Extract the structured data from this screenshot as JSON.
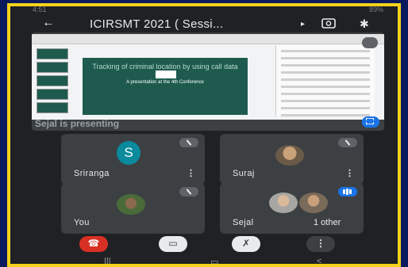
{
  "status_bar": {
    "time": "4:51",
    "battery": "89%"
  },
  "app_bar": {
    "title": "ICIRSMT 2021 ( Sessi...",
    "back_icon": "arrow-left-icon",
    "cast_icon": "cast-icon",
    "camera_icon": "camera-flip-icon",
    "audio_icon": "bluetooth-icon"
  },
  "presentation": {
    "presenter_label": "Sejal is presenting",
    "slide": {
      "title": "Tracking of criminal location by using call data record",
      "subtitle": "A presentation at the 4th Conference"
    }
  },
  "participants": [
    {
      "name": "Sriranga",
      "avatar_letter": "S",
      "mic": "muted"
    },
    {
      "name": "Suraj",
      "mic": "muted"
    },
    {
      "name": "You",
      "mic": "muted"
    },
    {
      "name": "Sejal",
      "extra": "1 other",
      "mic": "speaking"
    }
  ],
  "controls": {
    "end_call": "end-call-icon",
    "camera": "camera-off-icon",
    "mic": "mic-off-icon",
    "more": "more-vert-icon"
  },
  "colors": {
    "border": "#f7d21a",
    "background": "#202124",
    "tile": "#3c4043",
    "end": "#d93025",
    "accent": "#1a73e8"
  }
}
